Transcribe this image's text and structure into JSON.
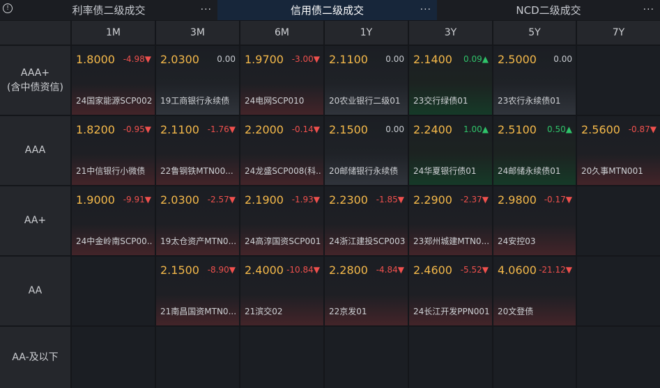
{
  "tabs": [
    {
      "label": "利率债二级成交",
      "more": "···"
    },
    {
      "label": "信用债二级成交",
      "more": "···"
    },
    {
      "label": "NCD二级成交",
      "more": "···"
    }
  ],
  "info_icon": "!",
  "columns": [
    "1M",
    "3M",
    "6M",
    "1Y",
    "3Y",
    "5Y",
    "7Y"
  ],
  "rows": [
    {
      "label": "AAA+",
      "sublabel": "(含中债资信)"
    },
    {
      "label": "AAA"
    },
    {
      "label": "AA+"
    },
    {
      "label": "AA"
    },
    {
      "label": "AA-及以下"
    }
  ],
  "cells": {
    "r0": [
      {
        "yield": "1.8000",
        "change": "-4.98▼",
        "name": "24国家能源SCP002",
        "dir": "down"
      },
      {
        "yield": "2.0300",
        "change": "0.00",
        "name": "19工商银行永续债",
        "dir": "flat"
      },
      {
        "yield": "1.9700",
        "change": "-3.00▼",
        "name": "24电网SCP010",
        "dir": "down"
      },
      {
        "yield": "2.1100",
        "change": "0.00",
        "name": "20农业银行二级01",
        "dir": "flat"
      },
      {
        "yield": "2.1400",
        "change": "0.09▲",
        "name": "23交行绿债01",
        "dir": "up"
      },
      {
        "yield": "2.5000",
        "change": "0.00",
        "name": "23农行永续债01",
        "dir": "flat"
      },
      null
    ],
    "r1": [
      {
        "yield": "1.8200",
        "change": "-0.95▼",
        "name": "21中信银行小微债",
        "dir": "down"
      },
      {
        "yield": "2.1100",
        "change": "-1.76▼",
        "name": "22鲁钢铁MTN00...",
        "dir": "down"
      },
      {
        "yield": "2.2000",
        "change": "-0.14▼",
        "name": "24龙盛SCP008(科...",
        "dir": "down"
      },
      {
        "yield": "2.1500",
        "change": "0.00",
        "name": "20邮储银行永续债",
        "dir": "flat"
      },
      {
        "yield": "2.2400",
        "change": "1.00▲",
        "name": "24华夏银行债01",
        "dir": "up"
      },
      {
        "yield": "2.5100",
        "change": "0.50▲",
        "name": "24邮储永续债01",
        "dir": "up"
      },
      {
        "yield": "2.5600",
        "change": "-0.87▼",
        "name": "20久事MTN001",
        "dir": "down"
      }
    ],
    "r2": [
      {
        "yield": "1.9000",
        "change": "-9.91▼",
        "name": "24中金岭南SCP00...",
        "dir": "down"
      },
      {
        "yield": "2.0300",
        "change": "-2.57▼",
        "name": "19太仓资产MTN0...",
        "dir": "down"
      },
      {
        "yield": "2.1900",
        "change": "-1.93▼",
        "name": "24高淳国资SCP001",
        "dir": "down"
      },
      {
        "yield": "2.2300",
        "change": "-1.85▼",
        "name": "24浙江建投SCP003",
        "dir": "down"
      },
      {
        "yield": "2.2900",
        "change": "-2.37▼",
        "name": "23郑州城建MTN0...",
        "dir": "down"
      },
      {
        "yield": "2.9800",
        "change": "-0.17▼",
        "name": "24安控03",
        "dir": "down"
      },
      null
    ],
    "r3": [
      null,
      {
        "yield": "2.1500",
        "change": "-8.90▼",
        "name": "21南昌国资MTN0...",
        "dir": "down"
      },
      {
        "yield": "2.4000",
        "change": "-10.84▼",
        "name": "21滨交02",
        "dir": "down"
      },
      {
        "yield": "2.2800",
        "change": "-4.84▼",
        "name": "22京发01",
        "dir": "down"
      },
      {
        "yield": "2.4600",
        "change": "-5.52▼",
        "name": "24长江开发PPN001",
        "dir": "down"
      },
      {
        "yield": "4.0600",
        "change": "-21.12▼",
        "name": "20文登债",
        "dir": "down"
      },
      null
    ],
    "r4": [
      null,
      null,
      null,
      null,
      null,
      null,
      null
    ]
  }
}
